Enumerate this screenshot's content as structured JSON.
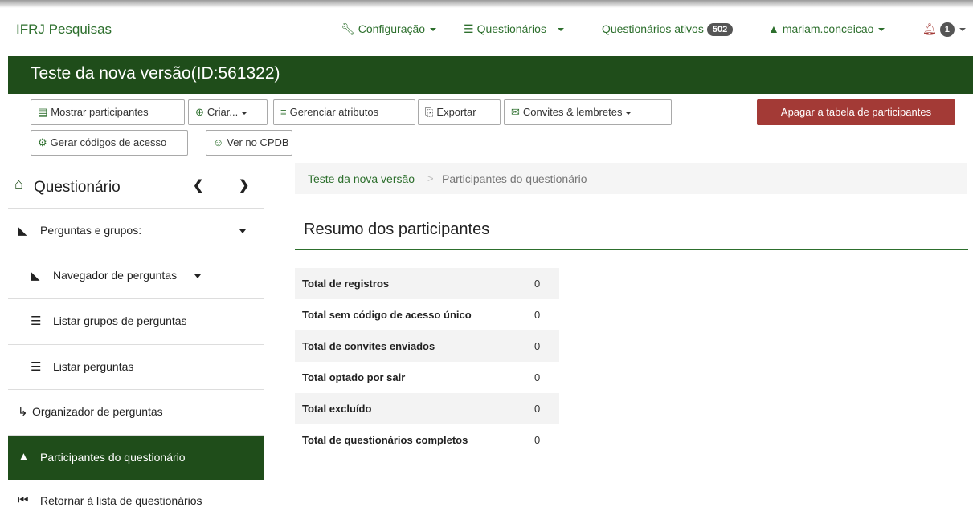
{
  "navbar": {
    "brand": "IFRJ Pesquisas",
    "config_label": "Configuração",
    "questionnaires_label": "Questionários",
    "active_label": "Questionários ativos",
    "active_count": "502",
    "user_label": "mariam.conceicao",
    "notifications_count": "1"
  },
  "title": "Teste da nova versão(ID:561322)",
  "toolbar": {
    "show_participants": "Mostrar participantes",
    "create": "Criar...",
    "manage_attributes": "Gerenciar atributos",
    "export": "Exportar",
    "invitations": "Convites & lembretes",
    "delete_table": "Apagar a tabela de participantes",
    "generate_codes": "Gerar códigos de acesso",
    "view_cpdb": "Ver no CPDB"
  },
  "sidebar": {
    "header": "Questionário",
    "items": [
      {
        "label": "Perguntas e grupos:"
      },
      {
        "label": "Navegador de perguntas"
      },
      {
        "label": "Listar grupos de perguntas"
      },
      {
        "label": "Listar perguntas"
      },
      {
        "label": "Organizador de perguntas"
      },
      {
        "label": "Participantes do questionário"
      },
      {
        "label": "Retornar à lista de questionários"
      }
    ]
  },
  "breadcrumb": {
    "survey": "Teste da nova versão",
    "current": "Participantes do questionário"
  },
  "summary": {
    "title": "Resumo dos participantes",
    "rows": [
      {
        "label": "Total de registros",
        "value": "0"
      },
      {
        "label": "Total sem código de acesso único",
        "value": "0"
      },
      {
        "label": "Total de convites enviados",
        "value": "0"
      },
      {
        "label": "Total optado por sair",
        "value": "0"
      },
      {
        "label": "Total excluído",
        "value": "0"
      },
      {
        "label": "Total de questionários completos",
        "value": "0"
      }
    ]
  },
  "colors": {
    "brand_green": "#1f4d1a",
    "link_green": "#2d6f2d",
    "danger": "#a33a36"
  },
  "icons": [
    "wrench-icon",
    "list-icon",
    "user-icon",
    "bell-icon",
    "table-icon",
    "plus-circle-icon",
    "attributes-icon",
    "export-icon",
    "envelope-icon",
    "gear-icon",
    "users-icon",
    "home-icon",
    "chevron-left-icon",
    "chevron-right-icon",
    "folder-open-icon",
    "list-icon",
    "organizer-icon",
    "user-icon",
    "step-backward-icon"
  ]
}
